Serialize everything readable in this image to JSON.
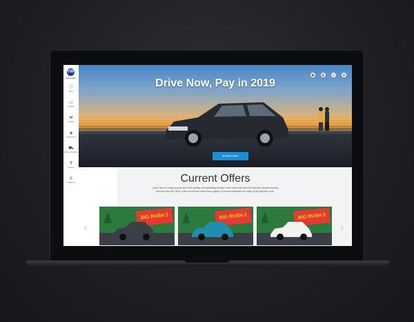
{
  "brand": {
    "logo_text": "VW",
    "name": "Volkswagen"
  },
  "sidebar": {
    "items": [
      {
        "icon": "info-icon",
        "glyph": "ⓘ",
        "label": "About"
      },
      {
        "icon": "car-icon",
        "glyph": "▭",
        "label": "Models"
      },
      {
        "icon": "wrench-icon",
        "glyph": "⚒",
        "label": "Service"
      },
      {
        "icon": "accessories-icon",
        "glyph": "◈",
        "label": "Accessories"
      },
      {
        "icon": "test-drive-icon",
        "glyph": "⛟",
        "label": "Book a Test Drive"
      },
      {
        "icon": "rupee-icon",
        "glyph": "₹",
        "label": "Finance"
      },
      {
        "icon": "phone-icon",
        "glyph": "✆",
        "label": "Contact Us"
      }
    ]
  },
  "hero": {
    "title": "Drive Now, Pay in 2019",
    "button_label": "Know more",
    "top_icons": [
      "location-icon",
      "globe-icon",
      "search-icon",
      "profile-icon"
    ]
  },
  "offers": {
    "title": "Current Offers",
    "description": "Lorem Ipsum is simply dummy text of the printing and typesetting industry. Lorem Ipsum has been the industry's standard dummy text ever since the 1500s, when an unknown printer took a galley of type and scrambled it to make a type specimen book.",
    "cards": [
      {
        "banner": "BIG RUSH 2",
        "car_color": "#3b3f46"
      },
      {
        "banner": "BIG RUSH 2",
        "car_color": "#1f8fb0"
      },
      {
        "banner": "BIG RUSH 2",
        "car_color": "#f2f2f2"
      }
    ]
  },
  "colors": {
    "accent": "#1a8fd8",
    "brand": "#1c3f8f"
  }
}
